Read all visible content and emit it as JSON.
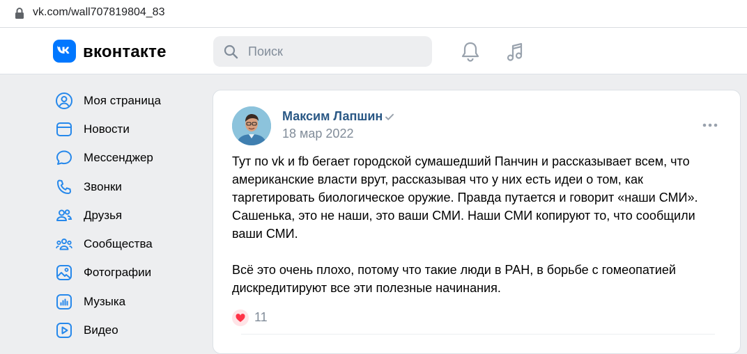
{
  "browser": {
    "url": "vk.com/wall707819804_83",
    "lock_icon": "lock-icon"
  },
  "header": {
    "brand": "вконтакте",
    "logo_icon": "vk-logo-icon",
    "search_placeholder": "Поиск",
    "notifications_icon": "bell-icon",
    "music_icon": "music-note-icon",
    "accent_color": "#0077ff"
  },
  "sidebar": {
    "items": [
      {
        "label": "Моя страница",
        "icon": "user-circle-icon"
      },
      {
        "label": "Новости",
        "icon": "news-icon"
      },
      {
        "label": "Мессенджер",
        "icon": "message-bubble-icon"
      },
      {
        "label": "Звонки",
        "icon": "phone-icon"
      },
      {
        "label": "Друзья",
        "icon": "friends-icon"
      },
      {
        "label": "Сообщества",
        "icon": "communities-icon"
      },
      {
        "label": "Фотографии",
        "icon": "photo-icon"
      },
      {
        "label": "Музыка",
        "icon": "music-icon"
      },
      {
        "label": "Видео",
        "icon": "video-icon"
      }
    ]
  },
  "post": {
    "author": "Максим Лапшин",
    "verified": true,
    "date": "18 мар 2022",
    "paragraphs": [
      "Тут по vk и fb бегает городской сумашедший Панчин и рассказывает всем, что\nамериканские власти врут, рассказывая что у них есть идеи о том, как\nтаргетировать биологическое оружие. Правда путается и говорит «наши СМИ».\nСашенька, это не наши, это ваши СМИ. Наши СМИ копируют то, что сообщили\nваши СМИ.",
      "Всё это очень плохо, потому что такие люди в РАН, в борьбе с гомеопатией\nдискредитируют все эти полезные начинания."
    ],
    "likes": "11",
    "like_color": "#ff3347",
    "link_color": "#2a5885"
  }
}
